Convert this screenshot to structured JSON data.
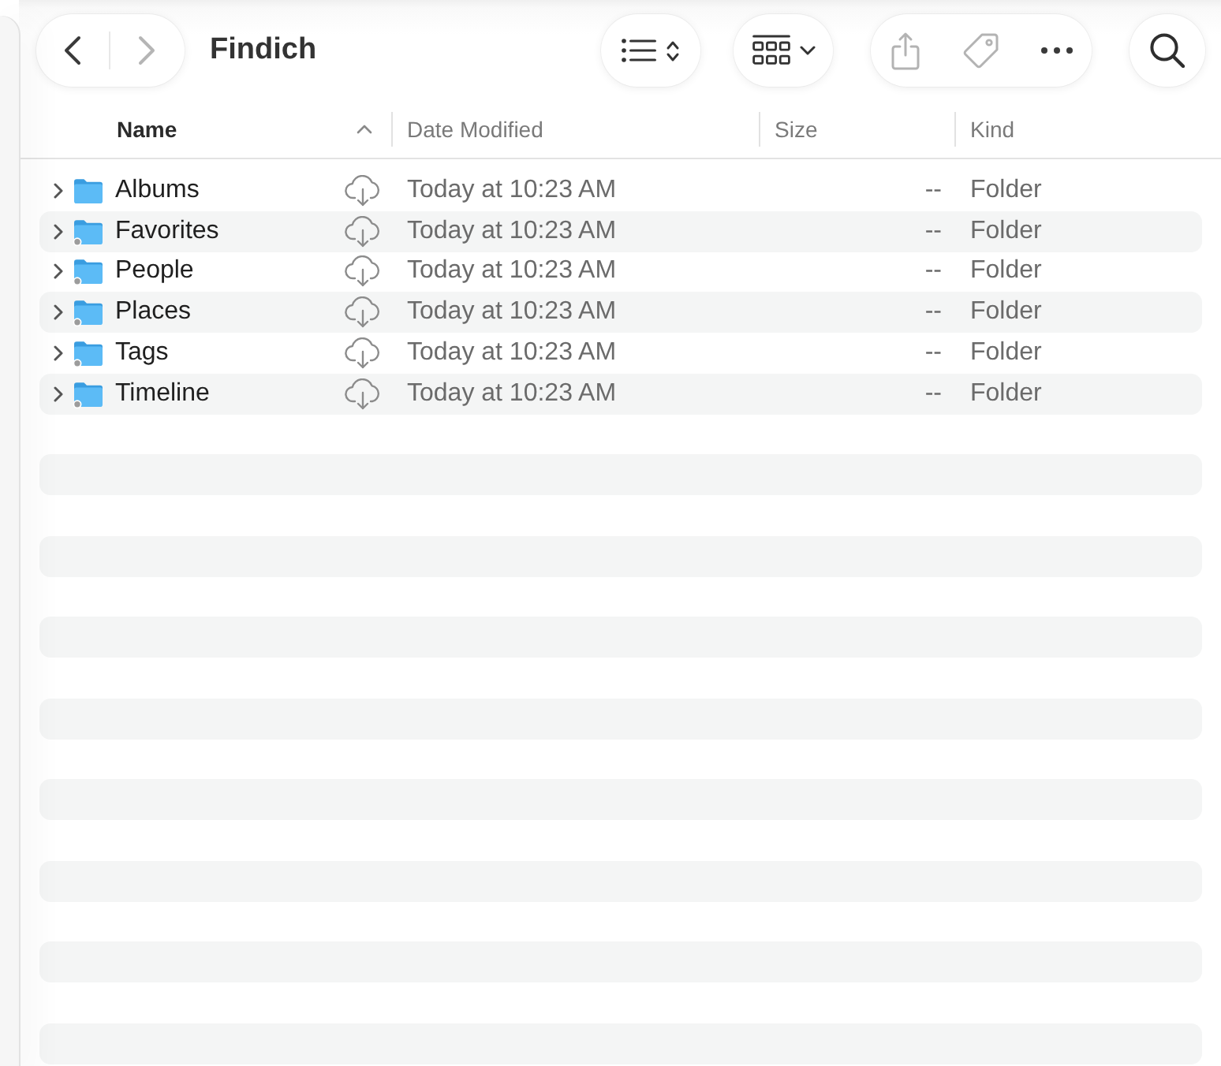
{
  "window": {
    "title": "Findich"
  },
  "toolbar": {
    "navigation": [
      {
        "kind": "back",
        "disabled": false
      },
      {
        "kind": "forward",
        "disabled": true
      }
    ],
    "view_buttons": [
      {
        "kind": "list"
      },
      {
        "kind": "grid"
      }
    ],
    "actions": [
      {
        "kind": "share",
        "disabled": true
      },
      {
        "kind": "tag",
        "disabled": true
      },
      {
        "kind": "more",
        "disabled": false
      }
    ]
  },
  "columns": [
    {
      "label": "Name",
      "sorted": true
    },
    {
      "label": "Date Modified",
      "sorted": false
    },
    {
      "label": "Size",
      "sorted": false
    },
    {
      "label": "Kind",
      "sorted": false
    }
  ],
  "rows": [
    {
      "name": "Albums",
      "selected": false,
      "expanded": false,
      "alias_badge": false,
      "in_cloud": true,
      "date_modified": "Today at 10:23 AM",
      "size": "--",
      "file_kind": "Folder"
    },
    {
      "name": "Favorites",
      "selected": false,
      "expanded": false,
      "alias_badge": true,
      "in_cloud": true,
      "date_modified": "Today at 10:23 AM",
      "size": "--",
      "file_kind": "Folder"
    },
    {
      "name": "People",
      "selected": false,
      "expanded": false,
      "alias_badge": true,
      "in_cloud": true,
      "date_modified": "Today at 10:23 AM",
      "size": "--",
      "file_kind": "Folder"
    },
    {
      "name": "Places",
      "selected": false,
      "expanded": false,
      "alias_badge": true,
      "in_cloud": true,
      "date_modified": "Today at 10:23 AM",
      "size": "--",
      "file_kind": "Folder"
    },
    {
      "name": "Tags",
      "selected": false,
      "expanded": false,
      "alias_badge": true,
      "in_cloud": true,
      "date_modified": "Today at 10:23 AM",
      "size": "--",
      "file_kind": "Folder"
    },
    {
      "name": "Timeline",
      "selected": false,
      "expanded": false,
      "alias_badge": true,
      "in_cloud": true,
      "date_modified": "Today at 10:23 AM",
      "size": "--",
      "file_kind": "Folder"
    }
  ]
}
